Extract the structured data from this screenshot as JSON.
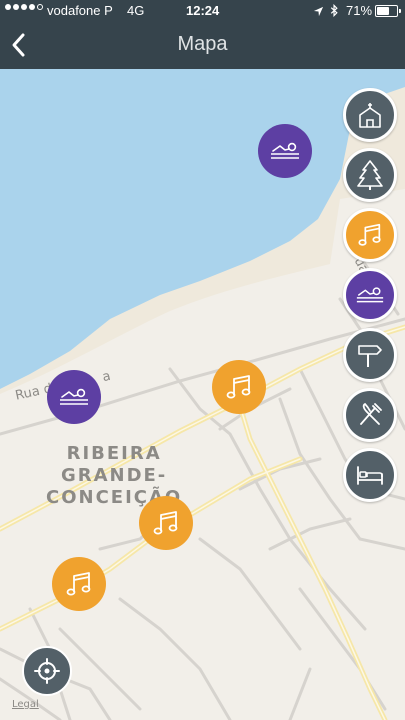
{
  "status_bar": {
    "carrier": "vodafone P",
    "network": "4G",
    "time": "12:24",
    "battery_text": "71%",
    "battery_level": 0.71,
    "signal_bars_filled": 4,
    "signal_bars_total": 5
  },
  "nav": {
    "title": "Mapa",
    "back_icon": "chevron-left-icon"
  },
  "map": {
    "district_label_line1": "RIBEIRA",
    "district_label_line2": "GRANDE-",
    "district_label_line3": "CONCEIÇÃO",
    "street_label_1": "Rua d",
    "street_label_1b": "a",
    "street_label_2": "ua da",
    "legal_link": "Legal",
    "pins": [
      {
        "type": "swimmer",
        "color": "#5d3fa3"
      },
      {
        "type": "swimmer",
        "color": "#5d3fa3"
      },
      {
        "type": "music",
        "color": "#f0a22e"
      },
      {
        "type": "music",
        "color": "#f0a22e"
      },
      {
        "type": "music",
        "color": "#f0a22e"
      }
    ]
  },
  "side_filters": [
    {
      "name": "church",
      "icon": "church-icon"
    },
    {
      "name": "nature",
      "icon": "tree-icon"
    },
    {
      "name": "music",
      "icon": "music-icon"
    },
    {
      "name": "beach",
      "icon": "swimmer-icon"
    },
    {
      "name": "trail",
      "icon": "signpost-icon"
    },
    {
      "name": "food",
      "icon": "fork-knife-icon"
    },
    {
      "name": "lodging",
      "icon": "bed-icon"
    }
  ],
  "locate": {
    "icon": "crosshair-icon"
  },
  "colors": {
    "header": "#36444c",
    "water": "#aad3ec",
    "land": "#f2efe9",
    "beach": "#f0ebe0",
    "major_road": "#fbe8a6",
    "minor_road": "#d8d6d2",
    "pin_purple": "#5d3fa3",
    "pin_orange": "#f0a22e",
    "filter_gray": "#536068"
  }
}
